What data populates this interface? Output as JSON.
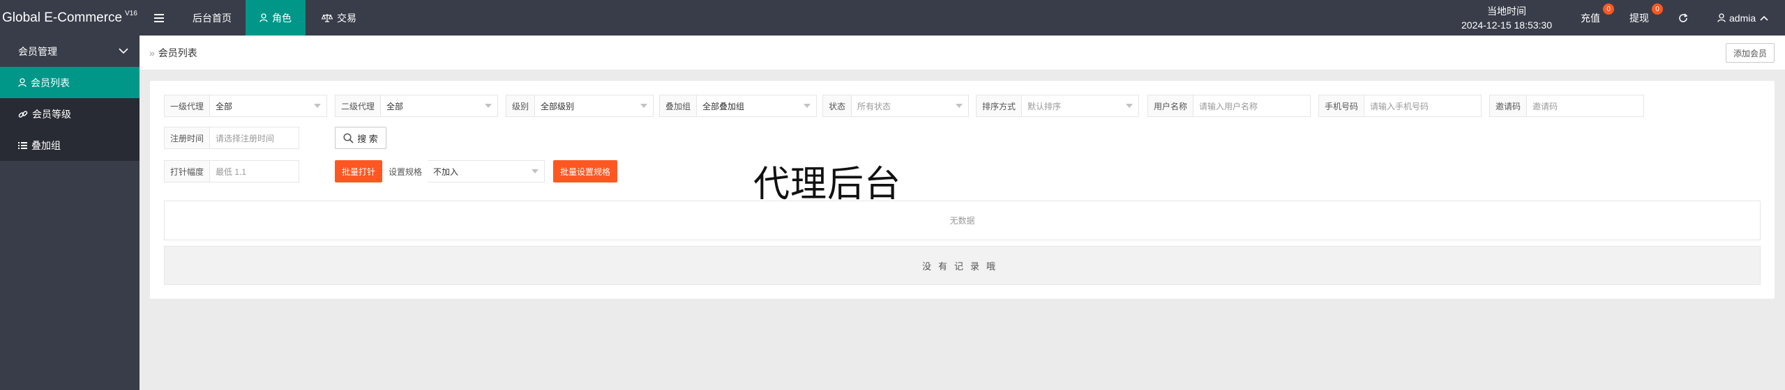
{
  "header": {
    "logo_text": "Global E-Commerce",
    "logo_version": "V16",
    "nav": [
      {
        "label": "后台首页"
      },
      {
        "label": "角色"
      },
      {
        "label": "交易"
      }
    ],
    "time_label": "当地时间",
    "time_value": "2024-12-15 18:53:30",
    "recharge_label": "充值",
    "recharge_count": "0",
    "withdraw_label": "提现",
    "withdraw_count": "0",
    "user_name": "admia"
  },
  "sidebar": {
    "group_label": "会员管理",
    "items": [
      {
        "label": "会员列表"
      },
      {
        "label": "会员等级"
      },
      {
        "label": "叠加组"
      }
    ]
  },
  "breadcrumb": {
    "current": "会员列表"
  },
  "toolbar": {
    "add_member_label": "添加会员"
  },
  "filters": {
    "agent1": {
      "label": "一级代理",
      "value": "全部"
    },
    "agent2": {
      "label": "二级代理",
      "value": "全部"
    },
    "level": {
      "label": "级别",
      "value": "全部级别"
    },
    "overlay_group": {
      "label": "叠加组",
      "value": "全部叠加组"
    },
    "status": {
      "label": "状态",
      "placeholder": "所有状态"
    },
    "sort": {
      "label": "排序方式",
      "placeholder": "默认排序"
    },
    "username": {
      "label": "用户名称",
      "placeholder": "请输入用户名称"
    },
    "phone": {
      "label": "手机号码",
      "placeholder": "请输入手机号码"
    },
    "invite": {
      "label": "邀请码",
      "placeholder": "邀请码"
    },
    "reg_time": {
      "label": "注册时间",
      "placeholder": "请选择注册时间"
    },
    "search_label": "搜 索"
  },
  "batch": {
    "amplitude": {
      "label": "打针幅度",
      "placeholder": "最低 1.1"
    },
    "batch_inject_label": "批量打针",
    "rule_label": "设置规格",
    "rule_value": "不加入",
    "batch_rule_label": "批量设置规格"
  },
  "overlay_title": "代理后台",
  "table": {
    "empty_text": "无数据",
    "no_record_text": "没有记录哦"
  }
}
